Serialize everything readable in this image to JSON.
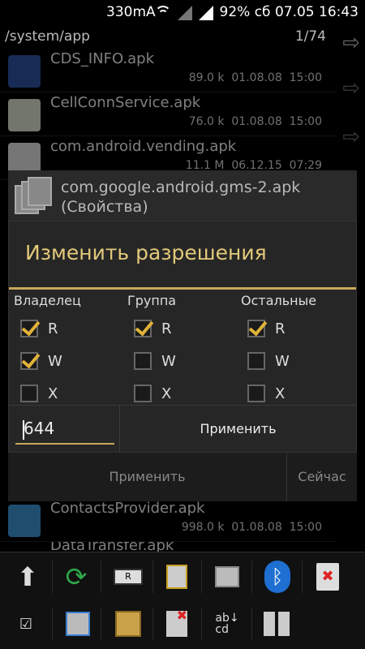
{
  "status_bar": {
    "speed": "330mA",
    "battery": "92%",
    "datetime": "сб 07.05 16:43"
  },
  "path_bar": {
    "path": "/system/app",
    "page": "1/74"
  },
  "files": [
    {
      "name": "CDS_INFO.apk",
      "size": "89.0 k",
      "date": "01.08.08",
      "time": "15:00",
      "icon": "android-app-icon"
    },
    {
      "name": "CellConnService.apk",
      "size": "76.0 k",
      "date": "01.08.08",
      "time": "15:00",
      "icon": "android-app-icon"
    },
    {
      "name": "com.android.vending.apk",
      "size": "11.1 M",
      "date": "06.12.15",
      "time": "07:29",
      "icon": "play-store-icon"
    },
    {
      "name": "ContactsProvider.apk",
      "size": "998.0 k",
      "date": "01.08.08",
      "time": "15:00",
      "icon": "contacts-icon"
    },
    {
      "name": "DataTransfer.apk",
      "size": "",
      "date": "",
      "time": "",
      "icon": "android-app-icon"
    }
  ],
  "properties_card": {
    "title_line1": "com.google.android.gms-2.apk",
    "title_line2": "(Свойства)",
    "apply": "Применить",
    "now": "Сейчас"
  },
  "dialog": {
    "title": "Изменить разрешения",
    "columns": [
      {
        "header": "Владелец",
        "r": true,
        "w": true,
        "x": false
      },
      {
        "header": "Группа",
        "r": true,
        "w": false,
        "x": false
      },
      {
        "header": "Остальные",
        "r": true,
        "w": false,
        "x": false
      }
    ],
    "labels": {
      "r": "R",
      "w": "W",
      "x": "X"
    },
    "mode_value": "644",
    "apply_button": "Применить"
  },
  "toolbar": [
    "up-icon",
    "refresh-icon",
    "rename-icon",
    "copy-icon",
    "move-icon",
    "bluetooth-icon",
    "delete-icon",
    "select-icon",
    "send-icon",
    "archive-icon",
    "delete-selected-icon",
    "sort-icon",
    "grid-icon"
  ]
}
